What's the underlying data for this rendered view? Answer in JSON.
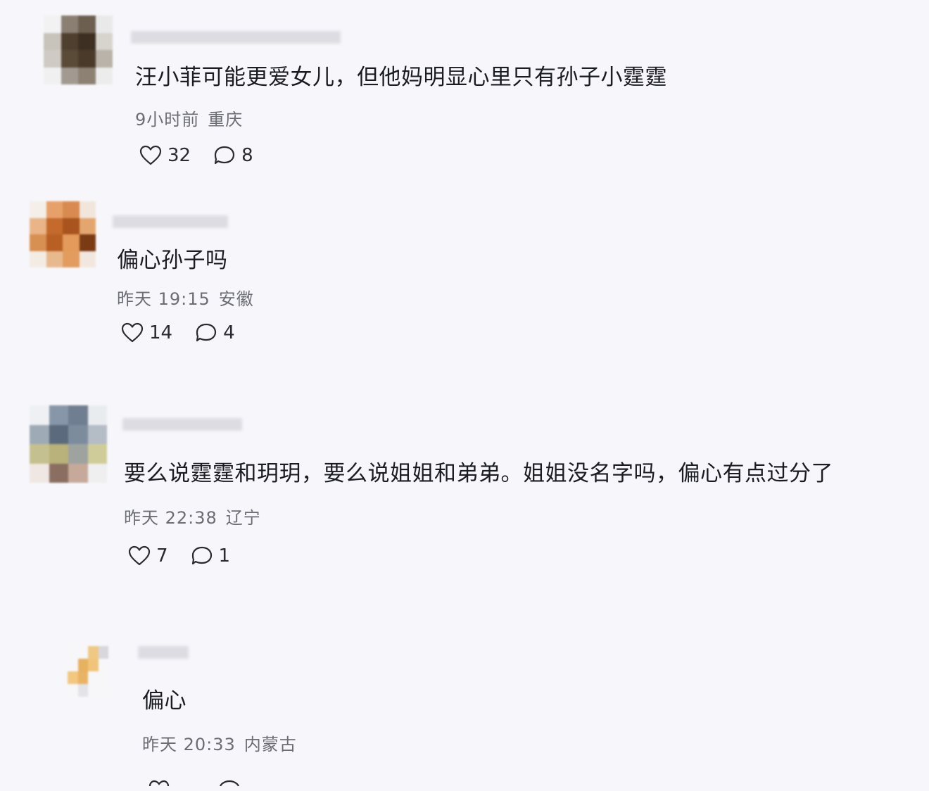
{
  "comments": [
    {
      "text": "汪小菲可能更爱女儿，但他妈明显心里只有孙子小霆霆",
      "time": "9小时前",
      "location": "重庆",
      "likes": "32",
      "replies": "8",
      "avatar_colors": [
        "#f2f2f2",
        "#8a7f72",
        "#6d5f50",
        "#e9e9ea",
        "#c8c3bb",
        "#4f3f2e",
        "#3d2f22",
        "#d7d3cd",
        "#cfcac3",
        "#5a4a38",
        "#4a3a29",
        "#b9b3aa",
        "#f0f0f0",
        "#a29a90",
        "#8d8174",
        "#ececec"
      ]
    },
    {
      "text": "偏心孙子吗",
      "time": "昨天 19:15",
      "location": "安徽",
      "likes": "14",
      "replies": "4",
      "avatar_colors": [
        "#f4efe9",
        "#e8a06a",
        "#d98a4f",
        "#f1e6dc",
        "#e9b488",
        "#c46a2c",
        "#a9531e",
        "#e3a66f",
        "#d88f52",
        "#b85f24",
        "#e49a5b",
        "#7a3a14",
        "#f3ece5",
        "#e9b98e",
        "#e29c5e",
        "#f2e7de"
      ]
    },
    {
      "text": "要么说霆霆和玥玥，要么说姐姐和弟弟。姐姐没名字吗，偏心有点过分了",
      "time": "昨天 22:38",
      "location": "辽宁",
      "likes": "7",
      "replies": "1",
      "avatar_colors": [
        "#eef0f3",
        "#8796a8",
        "#6f7e90",
        "#e9ecef",
        "#9eaab6",
        "#5b6a7c",
        "#7d8c9d",
        "#b4bcc5",
        "#c5c08f",
        "#b9b27a",
        "#9ea3a0",
        "#d0cc9a",
        "#efe7e2",
        "#8a6f60",
        "#c7a99a",
        "#efefef"
      ]
    },
    {
      "text": "偏心",
      "time": "昨天 20:33",
      "location": "内蒙古",
      "likes": "",
      "replies": "",
      "avatar_colors": [
        "#f7f7f9",
        "#f7f7f9",
        "#efc983",
        "#d7d7dc",
        "#f7f7f9",
        "#e6b25f",
        "#f0c57a",
        "#f7f7f9",
        "#f2c77e",
        "#e8b463",
        "#f7f7f9",
        "#f7f7f9",
        "#f7f7f9",
        "#e3e3e8",
        "#f7f7f9",
        "#f7f7f9"
      ]
    }
  ],
  "icons": {
    "like": "heart-outline-icon",
    "reply": "chat-bubble-icon"
  },
  "colors": {
    "background": "#f7f7fb",
    "meta_text": "#6c6c74",
    "name_blur": "#d9d9de"
  }
}
